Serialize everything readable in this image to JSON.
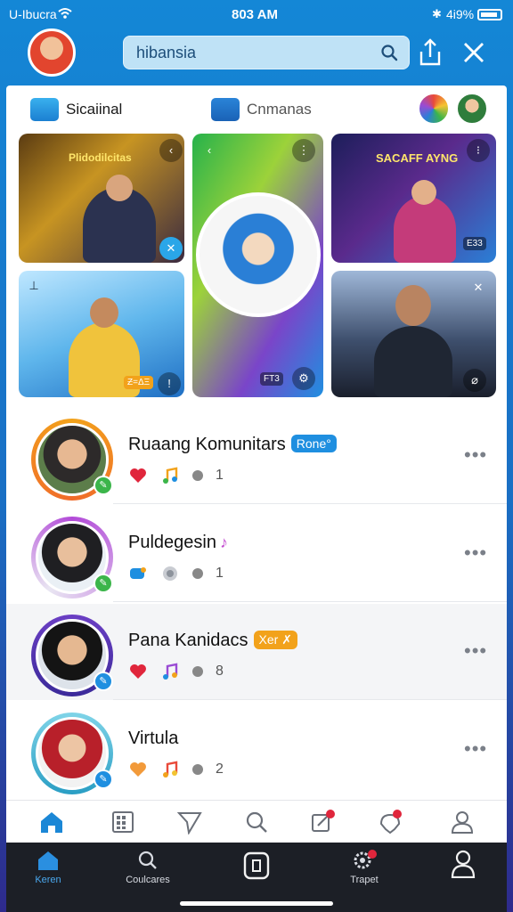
{
  "status": {
    "carrier": "U-Ibucra",
    "time": "803 AM",
    "battery": "4i9%"
  },
  "search": {
    "query": "hibansia"
  },
  "tabs": [
    {
      "label": "Sicaiinal"
    },
    {
      "label": "Cnmanas"
    }
  ],
  "media": {
    "tile1_caption": "Plidodilcitas",
    "tile1_chip": "",
    "tile3_caption": "SACAFF AYNG",
    "tile3_chip": "E33",
    "tile2_chip": "FT3",
    "tile4_chip": "Ƶ=ΔΞ"
  },
  "list": [
    {
      "name": "Ruaang Komunitars",
      "tag": "Rone°",
      "count": "1"
    },
    {
      "name": "Puldegesin",
      "tag": "",
      "count": "1"
    },
    {
      "name": "Pana Kanidacs",
      "tag": "Xer ✗",
      "count": "8"
    },
    {
      "name": "Virtula",
      "tag": "",
      "count": "2"
    }
  ],
  "bottom_nav": {
    "home": "Keren",
    "explore": "Coulcares",
    "trapet": "Trapet"
  },
  "colors": {
    "accent": "#1b87d6",
    "tag_blue": "#1f8fe0",
    "tag_orange": "#f2a21b",
    "heart": "#e0263c"
  }
}
